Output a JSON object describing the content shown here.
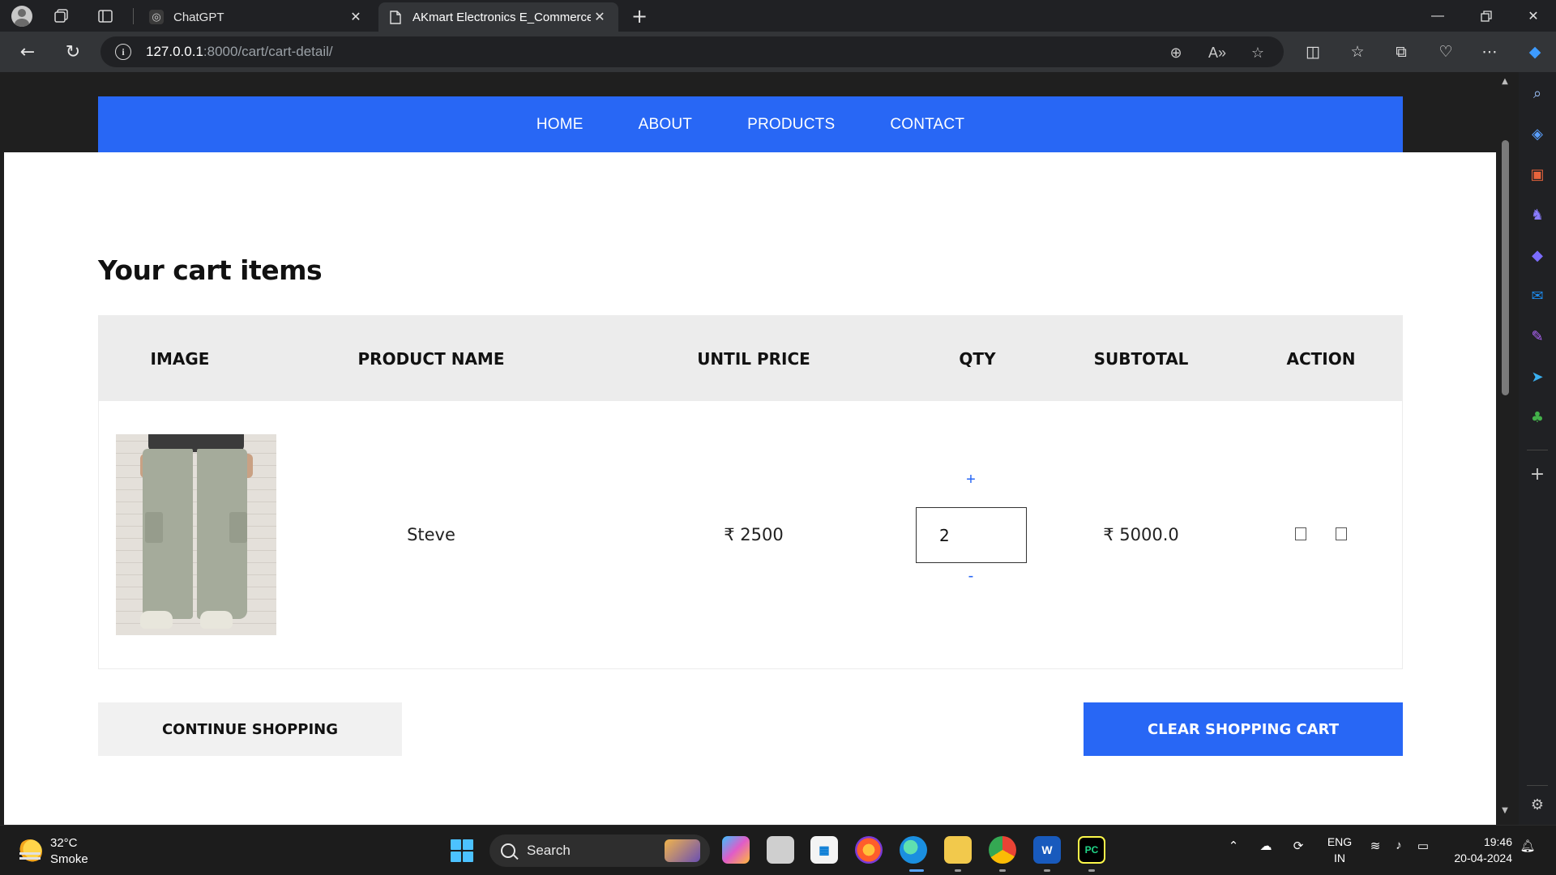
{
  "browser": {
    "tabs": [
      {
        "title": "ChatGPT",
        "active": false
      },
      {
        "title": "AKmart Electronics E_Commerce",
        "active": true
      }
    ],
    "url_host": "127.0.0.1",
    "url_rest": ":8000/cart/cart-detail/"
  },
  "site_nav": {
    "items": [
      "HOME",
      "ABOUT",
      "PRODUCTS",
      "CONTACT"
    ]
  },
  "cart": {
    "title": "Your cart items",
    "headers": [
      "IMAGE",
      "PRODUCT NAME",
      "UNTIL PRICE",
      "QTY",
      "SUBTOTAL",
      "ACTION"
    ],
    "rows": [
      {
        "image_icon": "cargo-pants-photo",
        "product_name": "Steve",
        "unit_price": "₹ 2500",
        "qty": "2",
        "qty_plus": "+",
        "qty_minus": "-",
        "subtotal": "₹ 5000.0"
      }
    ],
    "continue_label": "CONTINUE SHOPPING",
    "clear_label": "CLEAR SHOPPING CART"
  },
  "colors": {
    "accent": "#2867f5",
    "header_bg": "#ececec"
  },
  "taskbar": {
    "weather_temp": "32°C",
    "weather_desc": "Smoke",
    "search_placeholder": "Search",
    "lang_top": "ENG",
    "lang_bottom": "IN",
    "time": "19:46",
    "date": "20-04-2024"
  }
}
